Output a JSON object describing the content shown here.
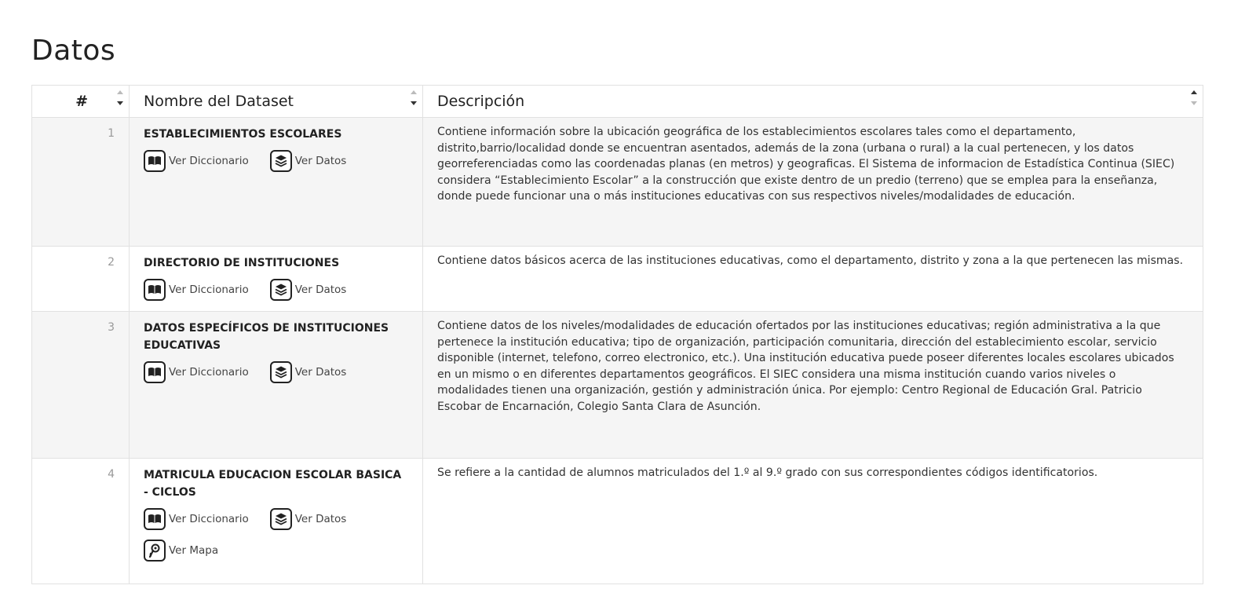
{
  "page": {
    "title": "Datos"
  },
  "table": {
    "headers": {
      "num": "#",
      "name": "Nombre del Dataset",
      "desc": "Descripción"
    },
    "link_labels": {
      "dictionary": "Ver Diccionario",
      "data": "Ver Datos",
      "map": "Ver Mapa"
    },
    "rows": [
      {
        "num": "1",
        "name": "ESTABLECIMIENTOS ESCOLARES",
        "desc": "Contiene información sobre la ubicación geográfica de los establecimientos escolares tales como el departamento, distrito,barrio/localidad donde se encuentran asentados, además de la zona (urbana o rural) a la cual pertenecen, y los datos georreferenciadas como las coordenadas planas (en metros) y geograficas. El Sistema de informacion de Estadística Continua (SIEC) considera “Establecimiento Escolar” a la construcción que existe dentro de un predio (terreno) que se emplea para la enseñanza, donde puede funcionar una o más instituciones educativas con sus respectivos niveles/modalidades de educación."
      },
      {
        "num": "2",
        "name": "DIRECTORIO DE INSTITUCIONES",
        "desc": "Contiene datos básicos acerca de las instituciones educativas, como el departamento, distrito y zona a la que pertenecen las mismas."
      },
      {
        "num": "3",
        "name": "DATOS ESPECÍFICOS DE INSTITUCIONES EDUCATIVAS",
        "desc": "Contiene datos de los niveles/modalidades de educación ofertados por las instituciones educativas; región administrativa a la que pertenece la institución educativa; tipo de organización, participación comunitaria, dirección del establecimiento escolar, servicio disponible (internet, telefono, correo electronico, etc.). Una institución educativa puede poseer diferentes locales escolares ubicados en un mismo o en diferentes departamentos geográficos. El SIEC considera una misma institución cuando varios niveles o modalidades tienen una organización, gestión y administración única. Por ejemplo: Centro Regional de Educación Gral. Patricio Escobar de Encarnación, Colegio Santa Clara de Asunción."
      },
      {
        "num": "4",
        "name": "MATRICULA EDUCACION ESCOLAR BASICA - CICLOS",
        "desc": "Se refiere a la cantidad de alumnos matriculados del 1.º al 9.º grado con sus correspondientes códigos identificatorios."
      }
    ]
  }
}
